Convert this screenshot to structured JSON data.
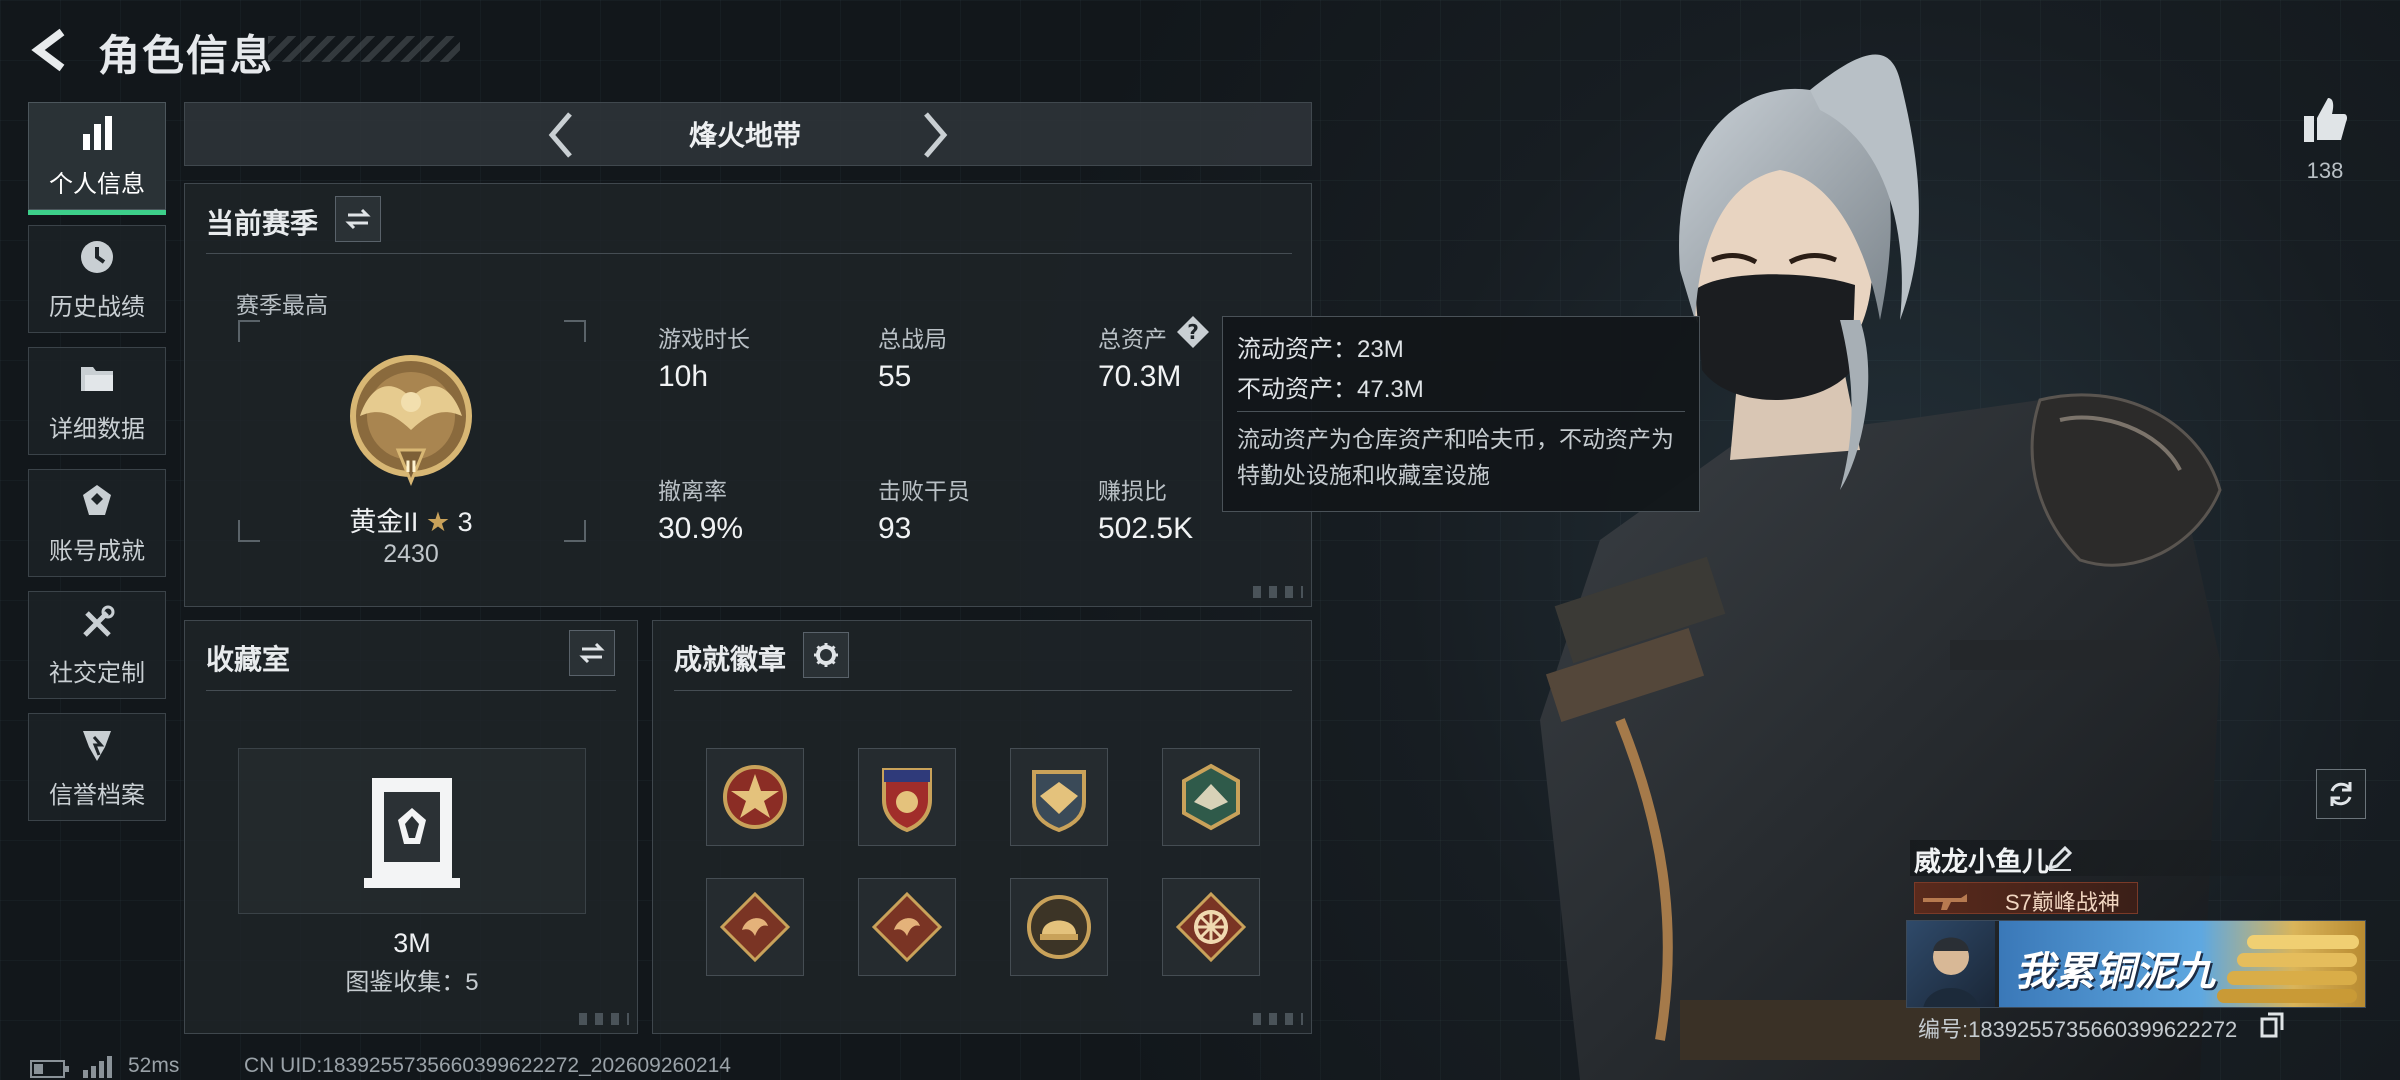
{
  "header": {
    "title": "角色信息"
  },
  "sidebar": {
    "items": [
      {
        "label": "个人信息",
        "icon": "bar-chart-icon"
      },
      {
        "label": "历史战绩",
        "icon": "clock-icon"
      },
      {
        "label": "详细数据",
        "icon": "folder-icon"
      },
      {
        "label": "账号成就",
        "icon": "achievement-icon"
      },
      {
        "label": "社交定制",
        "icon": "wrench-icon"
      },
      {
        "label": "信誉档案",
        "icon": "credit-shield-icon"
      }
    ]
  },
  "mode_selector": {
    "label": "烽火地带"
  },
  "season": {
    "title": "当前赛季",
    "best_label": "赛季最高",
    "rank": {
      "name": "黄金II",
      "stars": "3",
      "score": "2430",
      "emblem_numeral": "II"
    },
    "stats": [
      {
        "label": "游戏时长",
        "value": "10h"
      },
      {
        "label": "总战局",
        "value": "55"
      },
      {
        "label": "总资产",
        "value": "70.3M"
      },
      {
        "label": "撤离率",
        "value": "30.9%"
      },
      {
        "label": "击败干员",
        "value": "93"
      },
      {
        "label": "赚损比",
        "value": "502.5K"
      }
    ]
  },
  "tooltip": {
    "liquid": "流动资产：23M",
    "fixed": "不动资产：47.3M",
    "description": "流动资产为仓库资产和哈夫币，不动资产为特勤处设施和收藏室设施"
  },
  "collection": {
    "title": "收藏室",
    "value": "3M",
    "catalog": "图鉴收集：5"
  },
  "badges": {
    "title": "成就徽章",
    "items": [
      "star-medal-icon",
      "shield-medal-icon",
      "eagle-medal-icon",
      "hornet-medal-icon",
      "dragon-badge-icon",
      "dragon-badge-icon",
      "helmet-medal-icon",
      "wheel-badge-icon"
    ]
  },
  "player": {
    "likes": "138",
    "name": "威龙小鱼儿",
    "title_tag": "S7巅峰战神",
    "banner_text": "我累铜泥九",
    "id_line": "编号:1839255735660399622272"
  },
  "status": {
    "ping": "52ms",
    "uid": "CN UID:1839255735660399622272_202609260214"
  },
  "colors": {
    "accent": "#3dcf8a",
    "gold": "#c9a25a"
  }
}
